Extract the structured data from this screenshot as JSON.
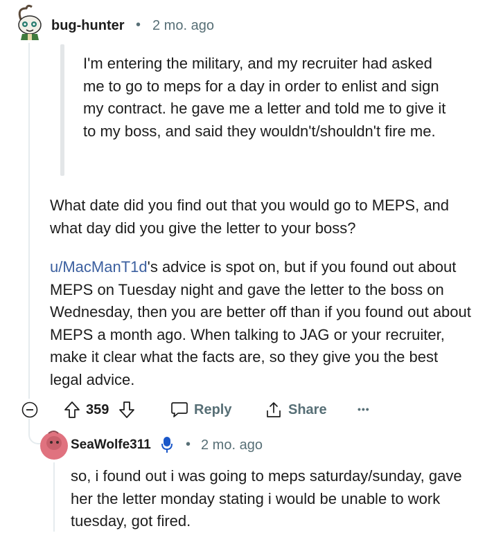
{
  "comment": {
    "username": "bug-hunter",
    "separator": "•",
    "time": "2 mo. ago",
    "quote": "I'm entering the military, and my recruiter had asked me to go to meps for a day in order to enlist and sign my contract. he gave me a letter and told me to give it to my boss, and said they wouldn't/shouldn't fire me.",
    "paragraph1": "What date did you find out that you would go to MEPS, and what day did you give the letter to your boss?",
    "mention": "u/MacManT1d",
    "paragraph2_rest": "'s advice is spot on, but if you found out about MEPS on Tuesday night and gave the letter to the boss on Wednesday, then you are better off than if you found out about MEPS a month ago. When talking to JAG or your recruiter, make it clear what the facts are, so they give you the best legal advice.",
    "actions": {
      "collapse_icon": "minus-circle-icon",
      "upvote_icon": "arrow-up-icon",
      "score": "359",
      "downvote_icon": "arrow-down-icon",
      "reply_label": "Reply",
      "share_label": "Share",
      "more_label": "•••"
    }
  },
  "reply": {
    "username": "SeaWolfe311",
    "badge_icon": "microphone-icon",
    "separator": "•",
    "time": "2 mo. ago",
    "text": "so, i found out i was going to meps saturday/sunday, gave her the letter monday stating i would be unable to work tuesday, got fired."
  },
  "colors": {
    "text": "#1c1c1c",
    "meta": "#576f76",
    "link": "#3b5f9f",
    "badge": "#1a57c9",
    "reply_avatar": "#e0727f"
  }
}
